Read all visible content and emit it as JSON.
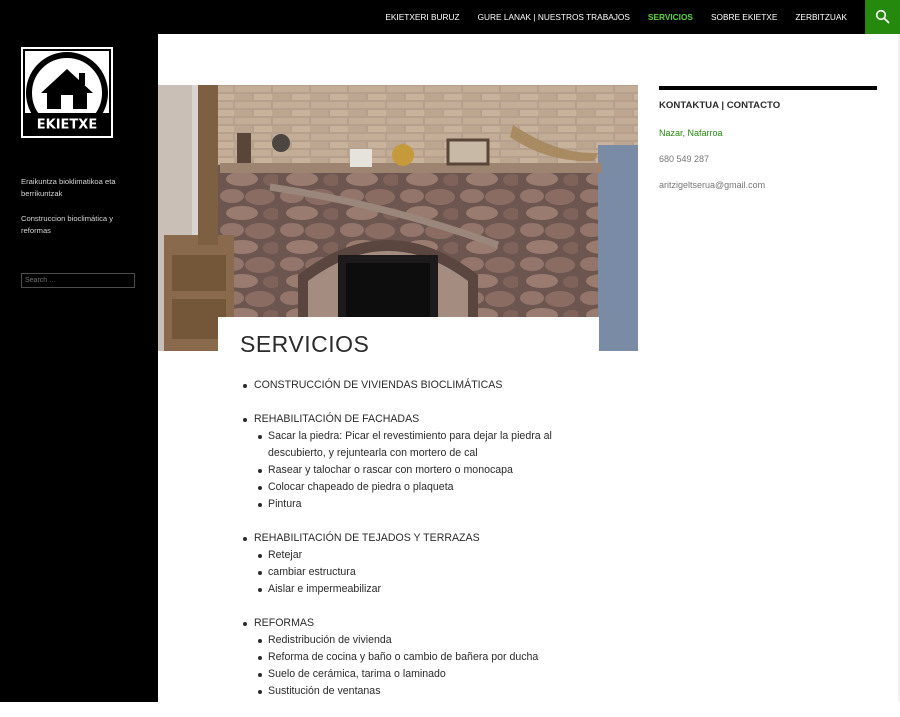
{
  "nav": {
    "items": [
      {
        "label": "EKIETXERI BURUZ"
      },
      {
        "label": "GURE LANAK | NUESTROS TRABAJOS"
      },
      {
        "label": "SERVICIOS"
      },
      {
        "label": "SOBRE EKIETXE"
      },
      {
        "label": "ZERBITZUAK"
      }
    ],
    "current_index": 2,
    "search_icon": "search-icon"
  },
  "colors": {
    "accent": "#24890d",
    "current_nav": "#55d737",
    "sidebar_bg": "#000000"
  },
  "site": {
    "logo_text": "EKIETXE",
    "description_eu": "Eraikuntza bioklimatikoa eta berrikuntzak",
    "description_es": "Construccion bioclimática y reformas",
    "search_placeholder": "Search …"
  },
  "entry": {
    "title": "SERVICIOS",
    "services": [
      {
        "title": "CONSTRUCCIÓN DE VIVIENDAS BIOCLIMÁTICAS",
        "items": []
      },
      {
        "title": "REHABILITACIÓN DE FACHADAS",
        "items": [
          "Sacar la piedra: Picar el revestimiento para dejar la piedra al descubierto, y rejuntearla con mortero de cal",
          "Rasear y talochar o rascar con mortero o monocapa",
          "Colocar chapeado de piedra o plaqueta",
          "Pintura"
        ]
      },
      {
        "title": "REHABILITACIÓN DE TEJADOS Y TERRAZAS",
        "items": [
          "Retejar",
          "cambiar estructura",
          "Aislar e impermeabilizar"
        ]
      },
      {
        "title": "REFORMAS",
        "items": [
          "Redistribución de vivienda",
          "Reforma de cocina y baño o cambio de bañera por ducha",
          "Suelo de cerámica, tarima o laminado",
          "Sustitución de ventanas"
        ]
      }
    ]
  },
  "widget": {
    "title": "KONTAKTUA | CONTACTO",
    "location": "Nazar, Nafarroa",
    "phone": "680 549 287",
    "email": "aritzigeltserua@gmail.com"
  }
}
